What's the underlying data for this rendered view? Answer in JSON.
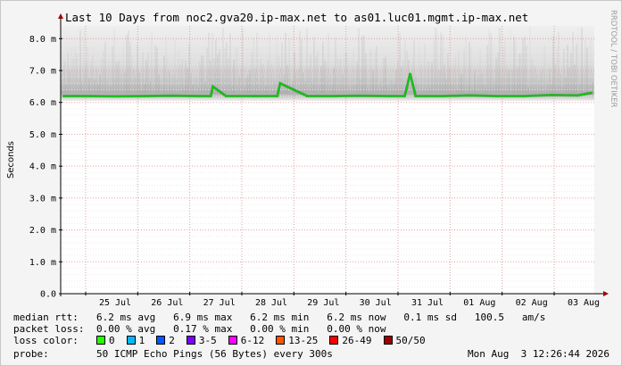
{
  "chart_data": {
    "type": "line",
    "title": "Last 10 Days from noc2.gva20.ip-max.net to as01.luc01.mgmt.ip-max.net",
    "ylabel": "Seconds",
    "side_label": "RRDTOOL / TOBI OETIKER",
    "y_ticks": [
      "0.0",
      "1.0 m",
      "2.0 m",
      "3.0 m",
      "4.0 m",
      "5.0 m",
      "6.0 m",
      "7.0 m",
      "8.0 m"
    ],
    "ylim": [
      0,
      8.4
    ],
    "y_unit": "ms",
    "x_ticks": [
      "25 Jul",
      "26 Jul",
      "27 Jul",
      "28 Jul",
      "29 Jul",
      "30 Jul",
      "31 Jul",
      "01 Aug",
      "02 Aug",
      "03 Aug"
    ],
    "grid": true,
    "series": [
      {
        "color": "#00cc00",
        "x": [
          0,
          0.5,
          1.0,
          1.5,
          2.0,
          2.5,
          2.72,
          2.76,
          3.0,
          3.5,
          3.95,
          4.0,
          4.5,
          5.0,
          5.5,
          6.0,
          6.3,
          6.4,
          6.5,
          7.0,
          7.5,
          8.0,
          8.5,
          9.0,
          9.5,
          9.75
        ],
        "values": [
          6.2,
          6.2,
          6.19,
          6.2,
          6.21,
          6.2,
          6.2,
          6.5,
          6.2,
          6.2,
          6.2,
          6.6,
          6.2,
          6.2,
          6.21,
          6.2,
          6.2,
          6.9,
          6.2,
          6.2,
          6.22,
          6.2,
          6.2,
          6.23,
          6.22,
          6.3
        ]
      }
    ]
  },
  "legend": {
    "median_rtt": {
      "label": "median rtt:",
      "values": "6.2 ms avg   6.9 ms max   6.2 ms min   6.2 ms now   0.1 ms sd   100.5   am/s"
    },
    "packet_loss": {
      "label": "packet loss:",
      "values": "0.00 % avg   0.17 % max   0.00 % min   0.00 % now"
    },
    "loss_color": {
      "label": "loss color:",
      "items": [
        {
          "label": "0",
          "color": "#26ff00"
        },
        {
          "label": "1",
          "color": "#00b8ff"
        },
        {
          "label": "2",
          "color": "#0059ff"
        },
        {
          "label": "3-5",
          "color": "#7e00ff"
        },
        {
          "label": "6-12",
          "color": "#ff00ff"
        },
        {
          "label": "13-25",
          "color": "#ff5500"
        },
        {
          "label": "26-49",
          "color": "#ff0000"
        },
        {
          "label": "50/50",
          "color": "#a10000"
        }
      ]
    },
    "probe": {
      "label": "probe:",
      "value": "50 ICMP Echo Pings (56 Bytes) every 300s",
      "timestamp": "Mon Aug  3 12:26:44 2026"
    }
  }
}
